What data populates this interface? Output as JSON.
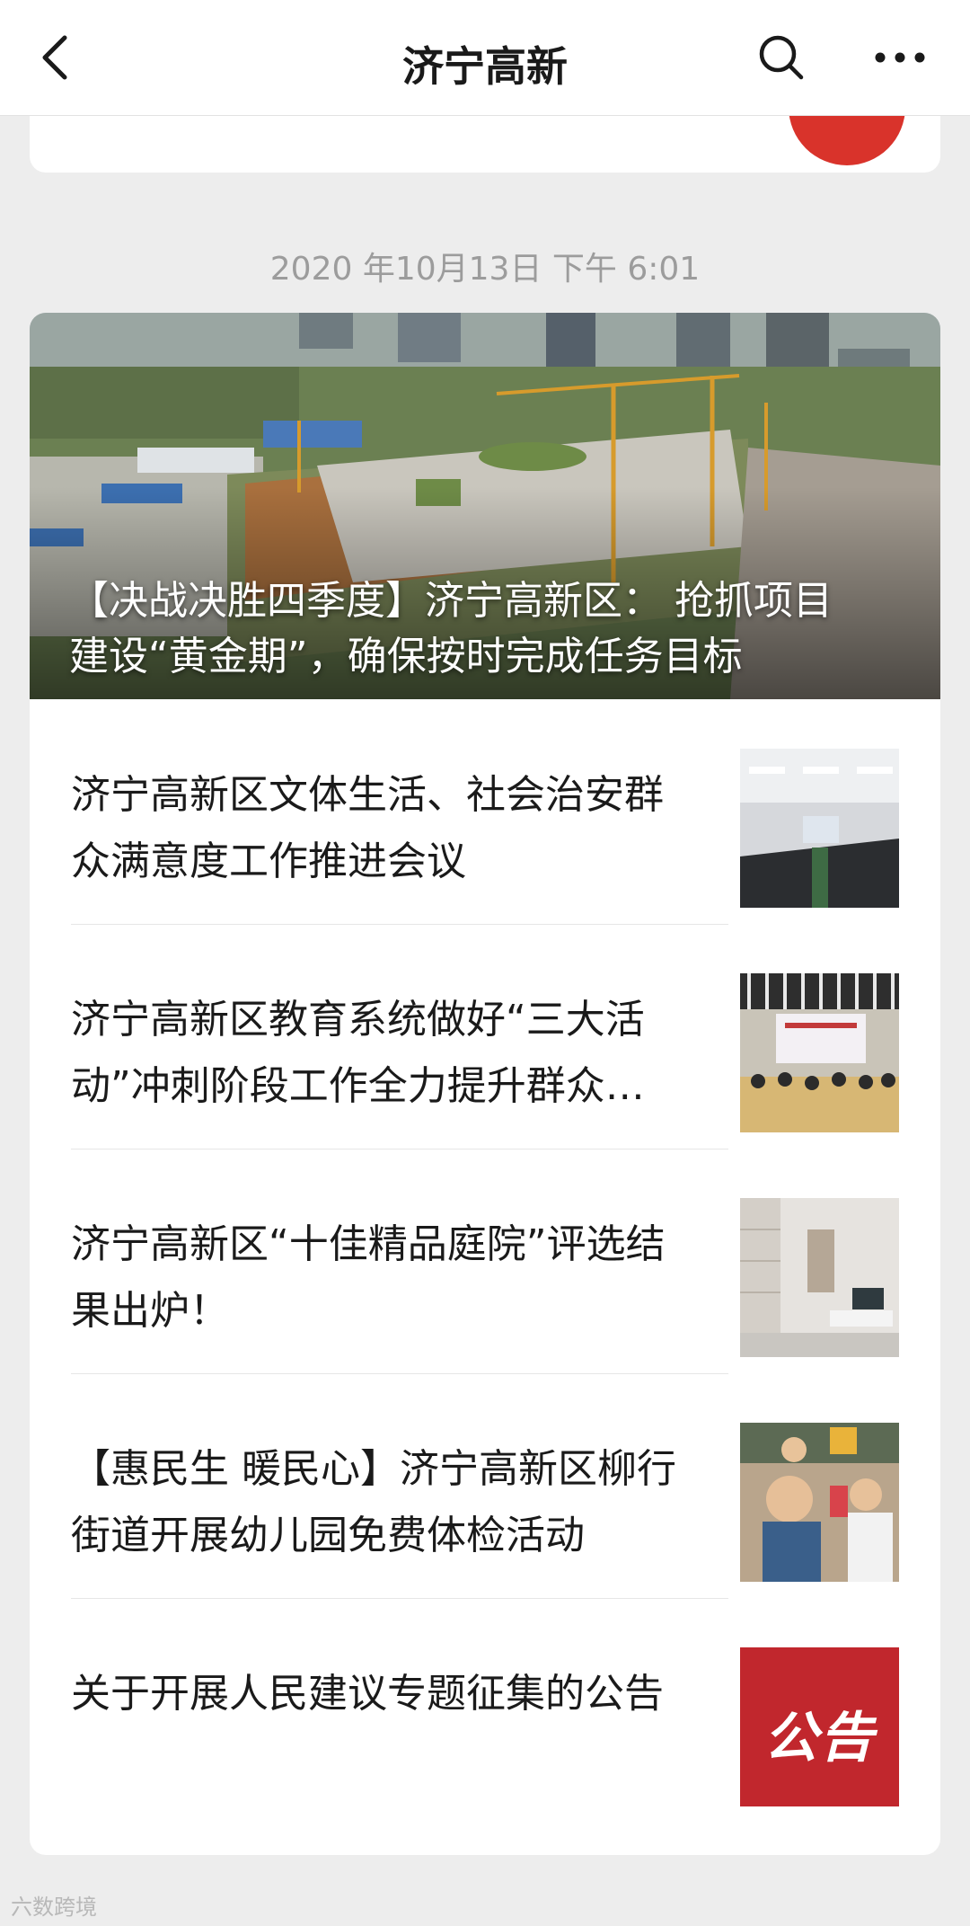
{
  "nav": {
    "title": "济宁高新",
    "back_icon": "chevron-left-icon",
    "search_icon": "search-icon",
    "more_icon": "more-dots-icon"
  },
  "timestamp": "2020 年10月13日 下午 6:01",
  "hero": {
    "title": "【决战决胜四季度】济宁高新区：  抢抓项目建设“黄金期”，确保按时完成任务目标"
  },
  "articles": [
    {
      "title": "济宁高新区文体生活、社会治安群众满意度工作推进会议"
    },
    {
      "title": "济宁高新区教育系统做好“三大活动”冲刺阶段工作全力提升群众…"
    },
    {
      "title": "济宁高新区“十佳精品庭院”评选结果出炉！"
    },
    {
      "title": "【惠民生 暖民心】济宁高新区柳行街道开展幼儿园免费体检活动"
    },
    {
      "title": "关于开展人民建议专题征集的公告",
      "thumb_text": "公告"
    }
  ],
  "watermark": "六数跨境",
  "colors": {
    "accent_red": "#d9332b",
    "background": "#ededed"
  }
}
